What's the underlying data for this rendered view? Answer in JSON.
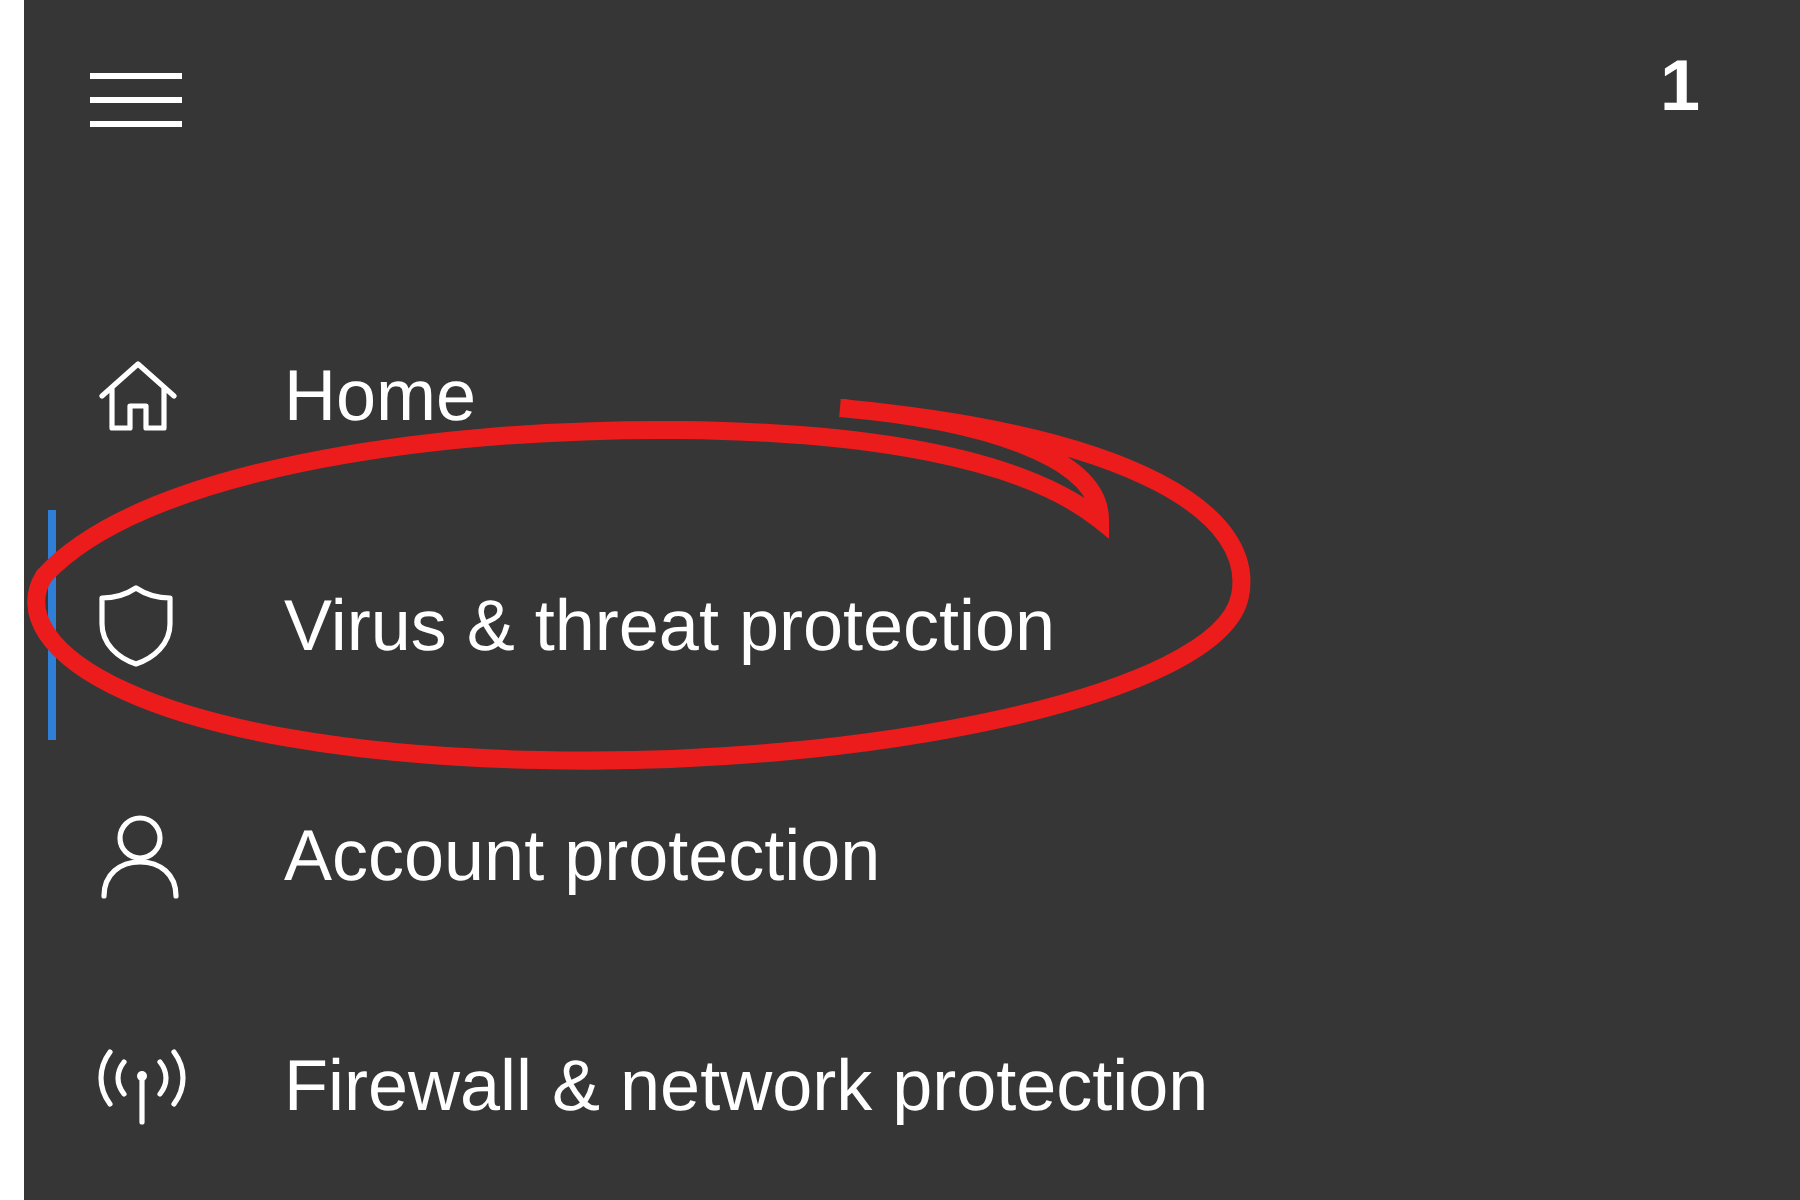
{
  "step": "1",
  "nav_items": [
    {
      "label": "Home",
      "kind": "home",
      "selected": false
    },
    {
      "label": "Virus & threat protection",
      "kind": "shield",
      "selected": true
    },
    {
      "label": "Account protection",
      "kind": "person",
      "selected": false
    },
    {
      "label": "Firewall & network protection",
      "kind": "antenna",
      "selected": false
    }
  ]
}
